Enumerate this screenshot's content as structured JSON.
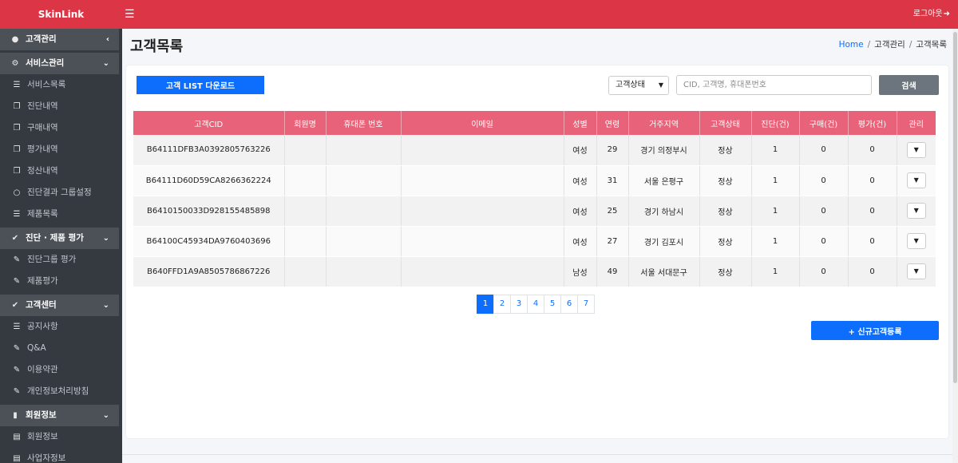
{
  "app": {
    "brand": "SkinLink",
    "logout_label": "로그아웃"
  },
  "sidebar": {
    "items": [
      {
        "type": "section",
        "label": "고객관리",
        "icon": "user-circle-icon",
        "chevron": "‹"
      },
      {
        "type": "section",
        "label": "서비스관리",
        "icon": "cogs-icon",
        "chevron": "⌄"
      },
      {
        "type": "item",
        "label": "서비스목록",
        "icon": "list-icon"
      },
      {
        "type": "item",
        "label": "진단내역",
        "icon": "copy-icon"
      },
      {
        "type": "item",
        "label": "구매내역",
        "icon": "copy-icon"
      },
      {
        "type": "item",
        "label": "평가내역",
        "icon": "copy-icon"
      },
      {
        "type": "item",
        "label": "정산내역",
        "icon": "copy-icon"
      },
      {
        "type": "item",
        "label": "진단결과 그룹설정",
        "icon": "circle-icon"
      },
      {
        "type": "item",
        "label": "제품목록",
        "icon": "list-icon"
      },
      {
        "type": "section",
        "label": "진단 · 제품 평가",
        "icon": "check-circle-icon",
        "chevron": "⌄"
      },
      {
        "type": "item",
        "label": "진단그룹 평가",
        "icon": "edit-icon"
      },
      {
        "type": "item",
        "label": "제품평가",
        "icon": "edit-icon"
      },
      {
        "type": "section",
        "label": "고객센터",
        "icon": "check-circle-icon",
        "chevron": "⌄"
      },
      {
        "type": "item",
        "label": "공지사항",
        "icon": "list-icon"
      },
      {
        "type": "item",
        "label": "Q&A",
        "icon": "edit-icon"
      },
      {
        "type": "item",
        "label": "이용약관",
        "icon": "edit-icon"
      },
      {
        "type": "item",
        "label": "개인정보처리방침",
        "icon": "edit-icon"
      },
      {
        "type": "section",
        "label": "회원정보",
        "icon": "id-badge-icon",
        "chevron": "⌄"
      },
      {
        "type": "item",
        "label": "회원정보",
        "icon": "id-card-icon"
      },
      {
        "type": "item",
        "label": "사업자정보",
        "icon": "id-card-icon"
      }
    ]
  },
  "header": {
    "title": "고객목록",
    "breadcrumb": [
      "Home",
      "고객관리",
      "고객목록"
    ]
  },
  "toolbar": {
    "download_label": "고객 LIST 다운로드",
    "status_select_value": "고객상태",
    "search_placeholder": "CID, 고객명, 휴대폰번호",
    "search_label": "검색"
  },
  "table": {
    "columns": [
      "고객CID",
      "회원명",
      "휴대폰 번호",
      "이메일",
      "성별",
      "연령",
      "거주지역",
      "고객상태",
      "진단(건)",
      "구매(건)",
      "평가(건)",
      "관리"
    ],
    "rows": [
      [
        "B64111DFB3A0392805763226",
        "",
        "",
        "",
        "여성",
        "29",
        "경기 의정부시",
        "정상",
        "1",
        "0",
        "0"
      ],
      [
        "B64111D60D59CA8266362224",
        "",
        "",
        "",
        "여성",
        "31",
        "서울 은평구",
        "정상",
        "1",
        "0",
        "0"
      ],
      [
        "B6410150033D928155485898",
        "",
        "",
        "",
        "여성",
        "25",
        "경기 하남시",
        "정상",
        "1",
        "0",
        "0"
      ],
      [
        "B64100C45934DA9760403696",
        "",
        "",
        "",
        "여성",
        "27",
        "경기 김포시",
        "정상",
        "1",
        "0",
        "0"
      ],
      [
        "B640FFD1A9A8505786867226",
        "",
        "",
        "",
        "남성",
        "49",
        "서울 서대문구",
        "정상",
        "1",
        "0",
        "0"
      ]
    ]
  },
  "pagination": {
    "pages": [
      "1",
      "2",
      "3",
      "4",
      "5",
      "6",
      "7"
    ],
    "current": "1"
  },
  "actions": {
    "new_customer_label": "+ 신규고객등록"
  },
  "colors": {
    "topbar": "#dc3545",
    "table_header": "#e8637a",
    "primary": "#0d6efd",
    "sidebar": "#343a40"
  }
}
